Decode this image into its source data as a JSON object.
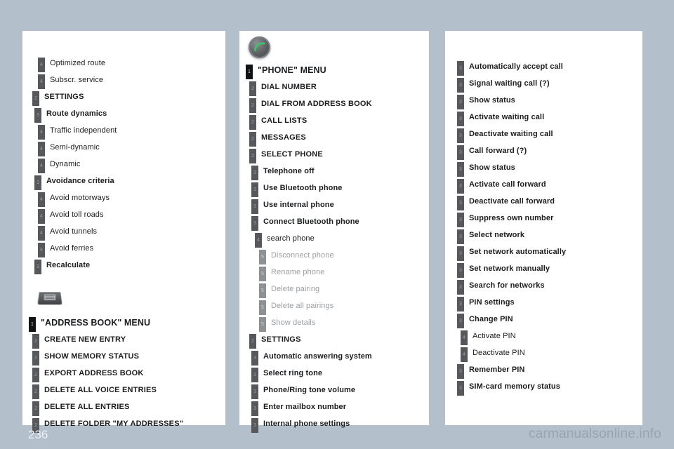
{
  "footer": {
    "page_number": "236",
    "watermark": "carmanualsonline.info"
  },
  "icons": {
    "address_book_key": "address-book-key-icon",
    "phone_key": "phone-key-icon"
  },
  "panels": [
    {
      "id": "panel-navigation-settings",
      "blocks": [
        {
          "type": "tree",
          "nodes": [
            {
              "level": 4,
              "badge": "4",
              "label": "Optimized route",
              "style": "normal"
            },
            {
              "level": 4,
              "badge": "4",
              "label": "Subscr. service",
              "style": "normal"
            },
            {
              "level": 2,
              "badge": "2",
              "label": "SETTINGS",
              "style": "caps"
            },
            {
              "level": 3,
              "badge": "3",
              "label": "Route dynamics",
              "style": "bold"
            },
            {
              "level": 4,
              "badge": "4",
              "label": "Traffic independent",
              "style": "normal"
            },
            {
              "level": 4,
              "badge": "4",
              "label": "Semi-dynamic",
              "style": "normal"
            },
            {
              "level": 4,
              "badge": "4",
              "label": "Dynamic",
              "style": "normal"
            },
            {
              "level": 3,
              "badge": "3",
              "label": "Avoidance criteria",
              "style": "bold"
            },
            {
              "level": 4,
              "badge": "4",
              "label": "Avoid motorways",
              "style": "normal"
            },
            {
              "level": 4,
              "badge": "4",
              "label": "Avoid toll roads",
              "style": "normal"
            },
            {
              "level": 4,
              "badge": "4",
              "label": "Avoid tunnels",
              "style": "normal"
            },
            {
              "level": 4,
              "badge": "4",
              "label": "Avoid ferries",
              "style": "normal"
            },
            {
              "level": 3,
              "badge": "3",
              "label": "Recalculate",
              "style": "bold"
            }
          ]
        },
        {
          "type": "icon",
          "icon": "address-book-key-icon"
        },
        {
          "type": "tree",
          "nodes": [
            {
              "level": 1,
              "badge": "1",
              "label": "\"ADDRESS BOOK\" MENU",
              "style": "title"
            },
            {
              "level": 2,
              "badge": "2",
              "label": "CREATE NEW ENTRY",
              "style": "caps"
            },
            {
              "level": 2,
              "badge": "2",
              "label": "SHOW MEMORY STATUS",
              "style": "caps"
            },
            {
              "level": 2,
              "badge": "2",
              "label": "EXPORT ADDRESS BOOK",
              "style": "caps"
            },
            {
              "level": 2,
              "badge": "2",
              "label": "DELETE ALL VOICE ENTRIES",
              "style": "caps"
            },
            {
              "level": 2,
              "badge": "2",
              "label": "DELETE ALL ENTRIES",
              "style": "caps"
            },
            {
              "level": 2,
              "badge": "2",
              "label": "DELETE FOLDER \"MY ADDRESSES\"",
              "style": "caps"
            }
          ]
        }
      ]
    },
    {
      "id": "panel-phone-menu",
      "blocks": [
        {
          "type": "icon",
          "icon": "phone-key-icon"
        },
        {
          "type": "tree",
          "nodes": [
            {
              "level": 1,
              "badge": "1",
              "label": "\"PHONE\" MENU",
              "style": "title"
            },
            {
              "level": 2,
              "badge": "2",
              "label": "DIAL NUMBER",
              "style": "caps"
            },
            {
              "level": 2,
              "badge": "2",
              "label": "DIAL FROM ADDRESS BOOK",
              "style": "caps"
            },
            {
              "level": 2,
              "badge": "2",
              "label": "CALL LISTS",
              "style": "caps"
            },
            {
              "level": 2,
              "badge": "2",
              "label": "MESSAGES",
              "style": "caps"
            },
            {
              "level": 2,
              "badge": "2",
              "label": "SELECT PHONE",
              "style": "caps"
            },
            {
              "level": 3,
              "badge": "3",
              "label": "Telephone off",
              "style": "bold"
            },
            {
              "level": 3,
              "badge": "3",
              "label": "Use Bluetooth phone",
              "style": "bold"
            },
            {
              "level": 3,
              "badge": "3",
              "label": "Use internal phone",
              "style": "bold"
            },
            {
              "level": 3,
              "badge": "3",
              "label": "Connect Bluetooth phone",
              "style": "bold"
            },
            {
              "level": 4,
              "badge": "4",
              "label": "search phone",
              "style": "normal"
            },
            {
              "level": 5,
              "badge": "5",
              "label": "Disconnect phone",
              "style": "dim"
            },
            {
              "level": 5,
              "badge": "5",
              "label": "Rename phone",
              "style": "dim"
            },
            {
              "level": 5,
              "badge": "5",
              "label": "Delete pairing",
              "style": "dim"
            },
            {
              "level": 5,
              "badge": "5",
              "label": "Delete all pairings",
              "style": "dim"
            },
            {
              "level": 5,
              "badge": "5",
              "label": "Show details",
              "style": "dim"
            },
            {
              "level": 2,
              "badge": "2",
              "label": "SETTINGS",
              "style": "caps"
            },
            {
              "level": 3,
              "badge": "3",
              "label": "Automatic answering system",
              "style": "bold"
            },
            {
              "level": 3,
              "badge": "3",
              "label": "Select ring tone",
              "style": "bold"
            },
            {
              "level": 3,
              "badge": "3",
              "label": "Phone/Ring tone volume",
              "style": "bold"
            },
            {
              "level": 3,
              "badge": "3",
              "label": "Enter mailbox number",
              "style": "bold"
            },
            {
              "level": 3,
              "badge": "3",
              "label": "Internal phone settings",
              "style": "bold"
            }
          ]
        }
      ]
    },
    {
      "id": "panel-phone-settings-continued",
      "blocks": [
        {
          "type": "tree",
          "nodes": [
            {
              "level": 3,
              "badge": "3",
              "label": "Automatically accept call",
              "style": "bold"
            },
            {
              "level": 3,
              "badge": "3",
              "label": "Signal waiting call (?)",
              "style": "bold"
            },
            {
              "level": 3,
              "badge": "3",
              "label": "Show status",
              "style": "bold"
            },
            {
              "level": 3,
              "badge": "3",
              "label": "Activate waiting call",
              "style": "bold"
            },
            {
              "level": 3,
              "badge": "3",
              "label": "Deactivate waiting call",
              "style": "bold"
            },
            {
              "level": 3,
              "badge": "3",
              "label": "Call forward (?)",
              "style": "bold"
            },
            {
              "level": 3,
              "badge": "3",
              "label": "Show status",
              "style": "bold"
            },
            {
              "level": 3,
              "badge": "3",
              "label": "Activate call forward",
              "style": "bold"
            },
            {
              "level": 3,
              "badge": "3",
              "label": "Deactivate call forward",
              "style": "bold"
            },
            {
              "level": 3,
              "badge": "3",
              "label": "Suppress own number",
              "style": "bold"
            },
            {
              "level": 3,
              "badge": "3",
              "label": "Select network",
              "style": "bold"
            },
            {
              "level": 3,
              "badge": "3",
              "label": "Set network automatically",
              "style": "bold"
            },
            {
              "level": 3,
              "badge": "3",
              "label": "Set network manually",
              "style": "bold"
            },
            {
              "level": 3,
              "badge": "3",
              "label": "Search for networks",
              "style": "bold"
            },
            {
              "level": 3,
              "badge": "3",
              "label": "PIN settings",
              "style": "bold"
            },
            {
              "level": 3,
              "badge": "3",
              "label": "Change PIN",
              "style": "bold"
            },
            {
              "level": 4,
              "badge": "4",
              "label": "Activate PIN",
              "style": "normal"
            },
            {
              "level": 4,
              "badge": "4",
              "label": "Deactivate PIN",
              "style": "normal"
            },
            {
              "level": 3,
              "badge": "3",
              "label": "Remember PIN",
              "style": "bold"
            },
            {
              "level": 3,
              "badge": "3",
              "label": "SIM-card memory status",
              "style": "bold"
            }
          ]
        }
      ]
    }
  ]
}
